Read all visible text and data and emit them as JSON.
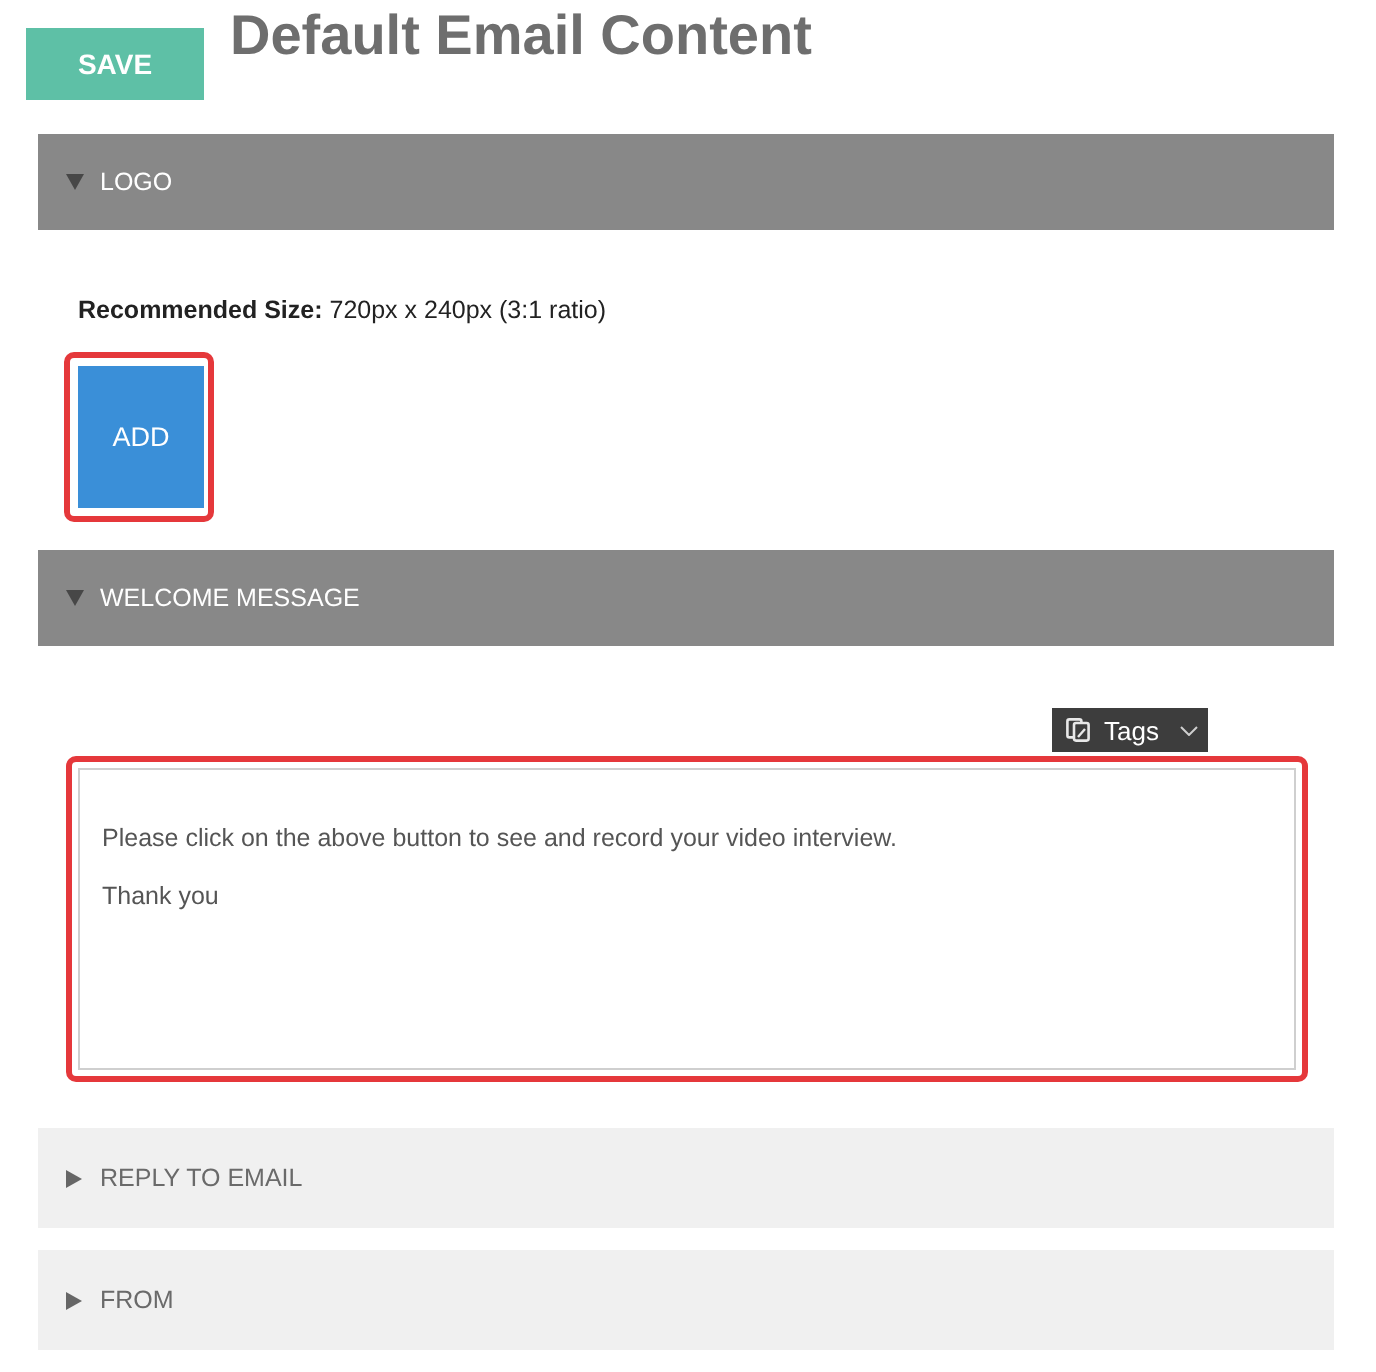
{
  "save_button": {
    "label": "SAVE"
  },
  "title": "Default Email Content",
  "sections": [
    {
      "title": "LOGO",
      "expanded": true,
      "kind": "logo",
      "note": "**Recommended Size:** 720px x 240px (3:1 ratio)",
      "button": {
        "label": "ADD",
        "highlighted": true
      }
    },
    {
      "title": "WELCOME MESSAGE",
      "expanded": true,
      "kind": "message",
      "tags_button": {
        "label": "Tags"
      },
      "editor": {
        "highlighted": true,
        "paragraphs": [
          "Please click on the above button to see and record your video interview.",
          "Thank you"
        ]
      }
    },
    {
      "title": "REPLY TO EMAIL",
      "expanded": false
    },
    {
      "title": "FROM",
      "expanded": false
    }
  ]
}
